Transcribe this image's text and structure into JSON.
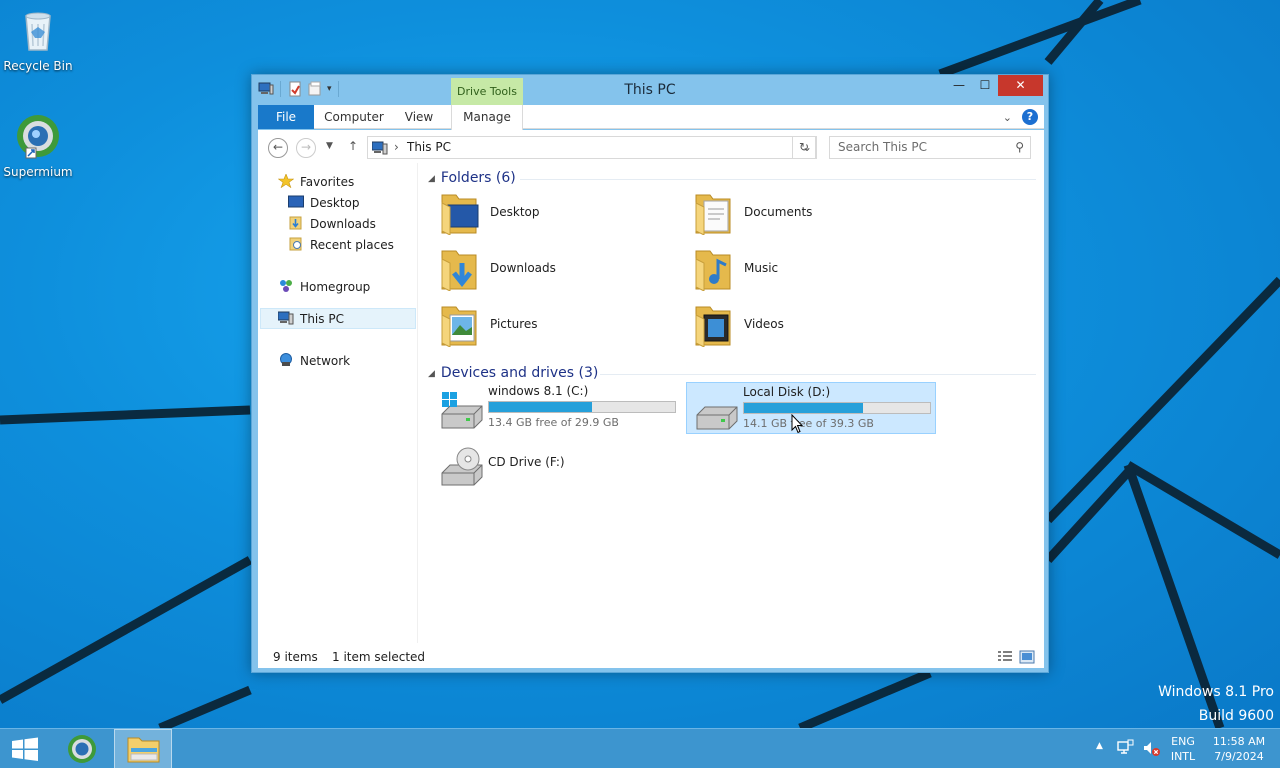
{
  "desktop": {
    "icons": [
      {
        "label": "Recycle Bin",
        "icon": "recycle-bin-icon"
      },
      {
        "label": "Supermium",
        "icon": "supermium-browser-icon"
      }
    ],
    "watermark": {
      "line1": "Windows 8.1 Pro",
      "line2": "Build 9600"
    }
  },
  "window": {
    "title": "This PC",
    "contextual_tab_group": "Drive Tools",
    "ribbon_tabs": [
      "File",
      "Computer",
      "View",
      "Manage"
    ],
    "address": {
      "crumb": "This PC"
    },
    "search": {
      "placeholder": "Search This PC"
    },
    "nav_pane": {
      "favorites": "Favorites",
      "favorites_items": [
        "Desktop",
        "Downloads",
        "Recent places"
      ],
      "homegroup": "Homegroup",
      "this_pc": "This PC",
      "network": "Network"
    },
    "folders": {
      "header": "Folders (6)",
      "items": [
        "Desktop",
        "Documents",
        "Downloads",
        "Music",
        "Pictures",
        "Videos"
      ]
    },
    "devices": {
      "header": "Devices and drives (3)",
      "drives": [
        {
          "name": "windows 8.1 (C:)",
          "free": "13.4 GB free of 29.9 GB",
          "used_fraction": 0.552
        },
        {
          "name": "Local Disk (D:)",
          "free": "14.1 GB free of 39.3 GB",
          "used_fraction": 0.641
        },
        {
          "name": "CD Drive (F:)"
        }
      ]
    },
    "status": {
      "items": "9 items",
      "selected": "1 item selected"
    }
  },
  "taskbar": {
    "lang_line1": "ENG",
    "lang_line2": "INTL",
    "time": "11:58 AM",
    "date": "7/9/2024"
  },
  "colors": {
    "accent": "#1979ca",
    "drive_bar": "#26a0da",
    "selection": "#cce8ff",
    "close": "#c7372c"
  }
}
